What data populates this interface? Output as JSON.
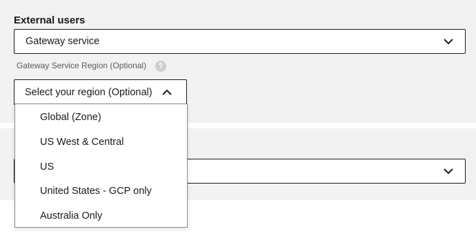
{
  "external_users": {
    "label": "External users",
    "gateway_select": {
      "value": "Gateway service"
    }
  },
  "region": {
    "label": "Gateway Service Region (Optional)",
    "help": "?",
    "select_value": "Select your region (Optional)",
    "options": [
      {
        "label": "Global (Zone)"
      },
      {
        "label": "US West & Central"
      },
      {
        "label": "US"
      },
      {
        "label": "United States - GCP only"
      },
      {
        "label": "Australia Only"
      }
    ]
  },
  "second_select": {
    "value": ""
  },
  "colors": {
    "panel": "#f2f2f2",
    "border": "#1a1a1a",
    "help_icon": "#cfcfcf"
  }
}
